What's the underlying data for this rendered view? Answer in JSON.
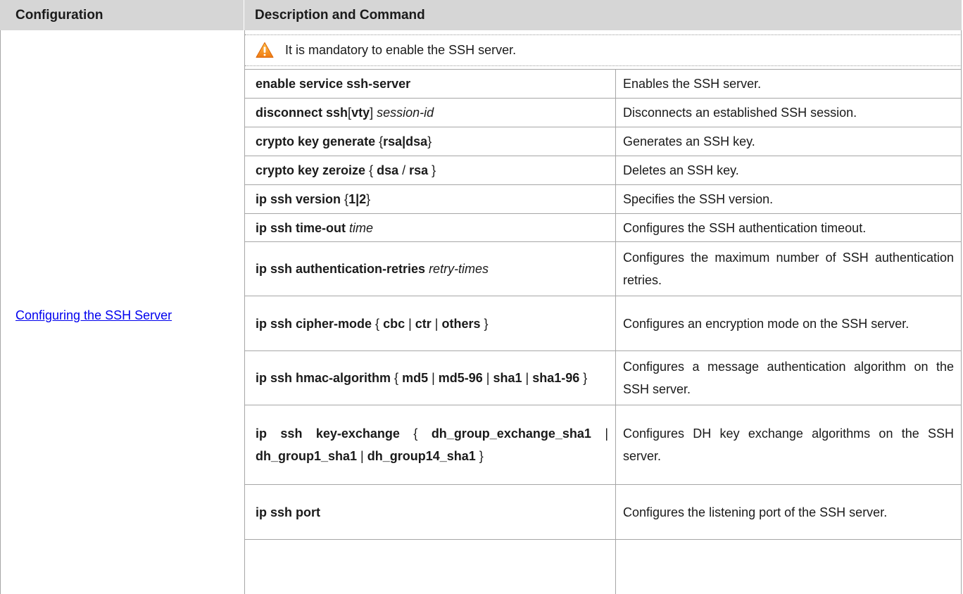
{
  "header": {
    "col1": "Configuration",
    "col2": "Description and Command"
  },
  "configuration_link": "Configuring the SSH Server",
  "note": {
    "icon": "warning-icon",
    "text": "It is mandatory to enable the SSH server."
  },
  "rows": [
    {
      "command_parts": [
        [
          "kw",
          "enable service ssh-server"
        ]
      ],
      "description": "Enables the SSH server."
    },
    {
      "command_parts": [
        [
          "kw",
          "disconnect ssh"
        ],
        [
          "txt",
          "["
        ],
        [
          "kw",
          "vty"
        ],
        [
          "txt",
          "] "
        ],
        [
          "arg",
          "session-id"
        ]
      ],
      "description": "Disconnects an established SSH session."
    },
    {
      "command_parts": [
        [
          "kw",
          "crypto key generate "
        ],
        [
          "txt",
          "{"
        ],
        [
          "kw",
          "rsa|dsa"
        ],
        [
          "txt",
          "}"
        ]
      ],
      "description": "Generates an SSH key."
    },
    {
      "command_parts": [
        [
          "kw",
          "crypto key zeroize "
        ],
        [
          "txt",
          "{ "
        ],
        [
          "kw",
          "dsa"
        ],
        [
          "txt",
          " / "
        ],
        [
          "kw",
          "rsa"
        ],
        [
          "txt",
          " }"
        ]
      ],
      "description": "Deletes an SSH key."
    },
    {
      "command_parts": [
        [
          "kw",
          "ip ssh version "
        ],
        [
          "txt",
          "{"
        ],
        [
          "kw",
          "1|2"
        ],
        [
          "txt",
          "}"
        ]
      ],
      "description": "Specifies the SSH version."
    },
    {
      "command_parts": [
        [
          "kw",
          "ip ssh time-out "
        ],
        [
          "arg",
          "time"
        ]
      ],
      "description": "Configures the SSH authentication timeout."
    },
    {
      "command_parts": [
        [
          "kw",
          "ip ssh authentication-retries "
        ],
        [
          "arg",
          "retry-times"
        ]
      ],
      "description": "Configures the maximum number of SSH authentication retries."
    },
    {
      "command_parts": [
        [
          "kw",
          "ip ssh cipher-mode "
        ],
        [
          "txt",
          "{ "
        ],
        [
          "kw",
          "cbc"
        ],
        [
          "txt",
          " | "
        ],
        [
          "kw",
          "ctr"
        ],
        [
          "txt",
          " | "
        ],
        [
          "kw",
          "others"
        ],
        [
          "txt",
          " }"
        ]
      ],
      "description": "Configures an encryption mode on the SSH server."
    },
    {
      "command_parts": [
        [
          "kw",
          "ip ssh hmac-algorithm "
        ],
        [
          "txt",
          "{ "
        ],
        [
          "kw",
          "md5"
        ],
        [
          "txt",
          " | "
        ],
        [
          "kw",
          "md5-96"
        ],
        [
          "txt",
          " | "
        ],
        [
          "kw",
          "sha1"
        ],
        [
          "txt",
          " | "
        ],
        [
          "kw",
          "sha1-96"
        ],
        [
          "txt",
          " }"
        ]
      ],
      "description": "Configures a message authentication algorithm on the SSH server."
    },
    {
      "command_parts": [
        [
          "kw",
          "ip ssh key-exchange "
        ],
        [
          "txt",
          "{ "
        ],
        [
          "kw",
          "dh_group_exchange_sha1"
        ],
        [
          "txt",
          " | "
        ],
        [
          "kw",
          "dh_group1_sha1"
        ],
        [
          "txt",
          " | "
        ],
        [
          "kw",
          "dh_group14_sha1"
        ],
        [
          "txt",
          " }"
        ]
      ],
      "description": "Configures DH key exchange algorithms on the SSH server."
    },
    {
      "command_parts": [
        [
          "kw",
          "ip ssh port"
        ]
      ],
      "description": "Configures the listening port of the SSH server."
    }
  ]
}
